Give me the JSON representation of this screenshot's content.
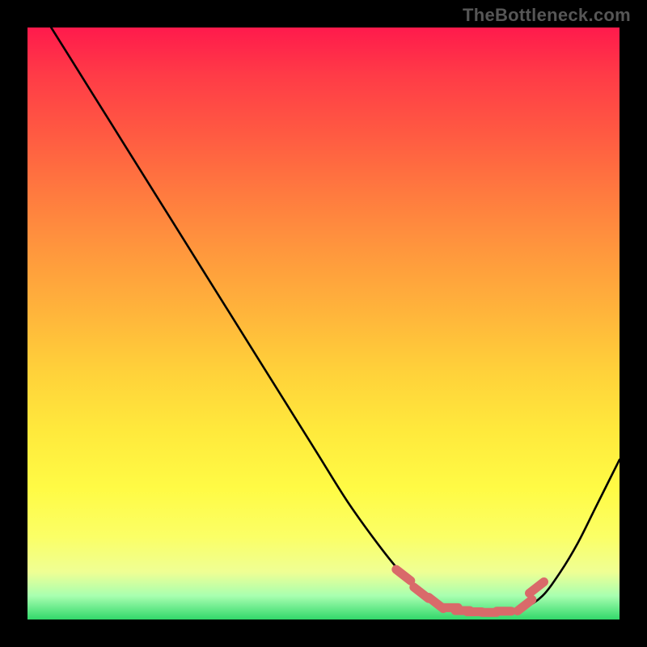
{
  "attribution": "TheBottleneck.com",
  "chart_data": {
    "type": "line",
    "title": "",
    "xlabel": "",
    "ylabel": "",
    "xlim": [
      0,
      100
    ],
    "ylim": [
      0,
      100
    ],
    "grid": false,
    "series": [
      {
        "name": "curve",
        "color": "#000000",
        "x": [
          4,
          9,
          14,
          19,
          24,
          29,
          34,
          39,
          44,
          49,
          54,
          59,
          63,
          66,
          69,
          72,
          75,
          78,
          81,
          84,
          87,
          90,
          93,
          96,
          100
        ],
        "values": [
          100,
          92,
          84,
          76,
          68,
          60,
          52,
          44,
          36,
          28,
          20,
          13,
          8,
          5,
          3,
          2,
          1,
          1,
          1,
          2,
          4,
          8,
          13,
          19,
          27
        ]
      },
      {
        "name": "highlight-dots",
        "color": "#d96a6a",
        "x": [
          63.5,
          66.5,
          69,
          71.5,
          73.5,
          75.5,
          78,
          80.5,
          84,
          86
        ],
        "values": [
          7.5,
          4.5,
          2.8,
          2.0,
          1.5,
          1.3,
          1.2,
          1.4,
          2.4,
          5.4
        ]
      }
    ],
    "gradient_stops": [
      {
        "pos": 0,
        "color": "#ff1a4c"
      },
      {
        "pos": 50,
        "color": "#ffc63b"
      },
      {
        "pos": 85,
        "color": "#fdff55"
      },
      {
        "pos": 100,
        "color": "#32d86a"
      }
    ]
  }
}
